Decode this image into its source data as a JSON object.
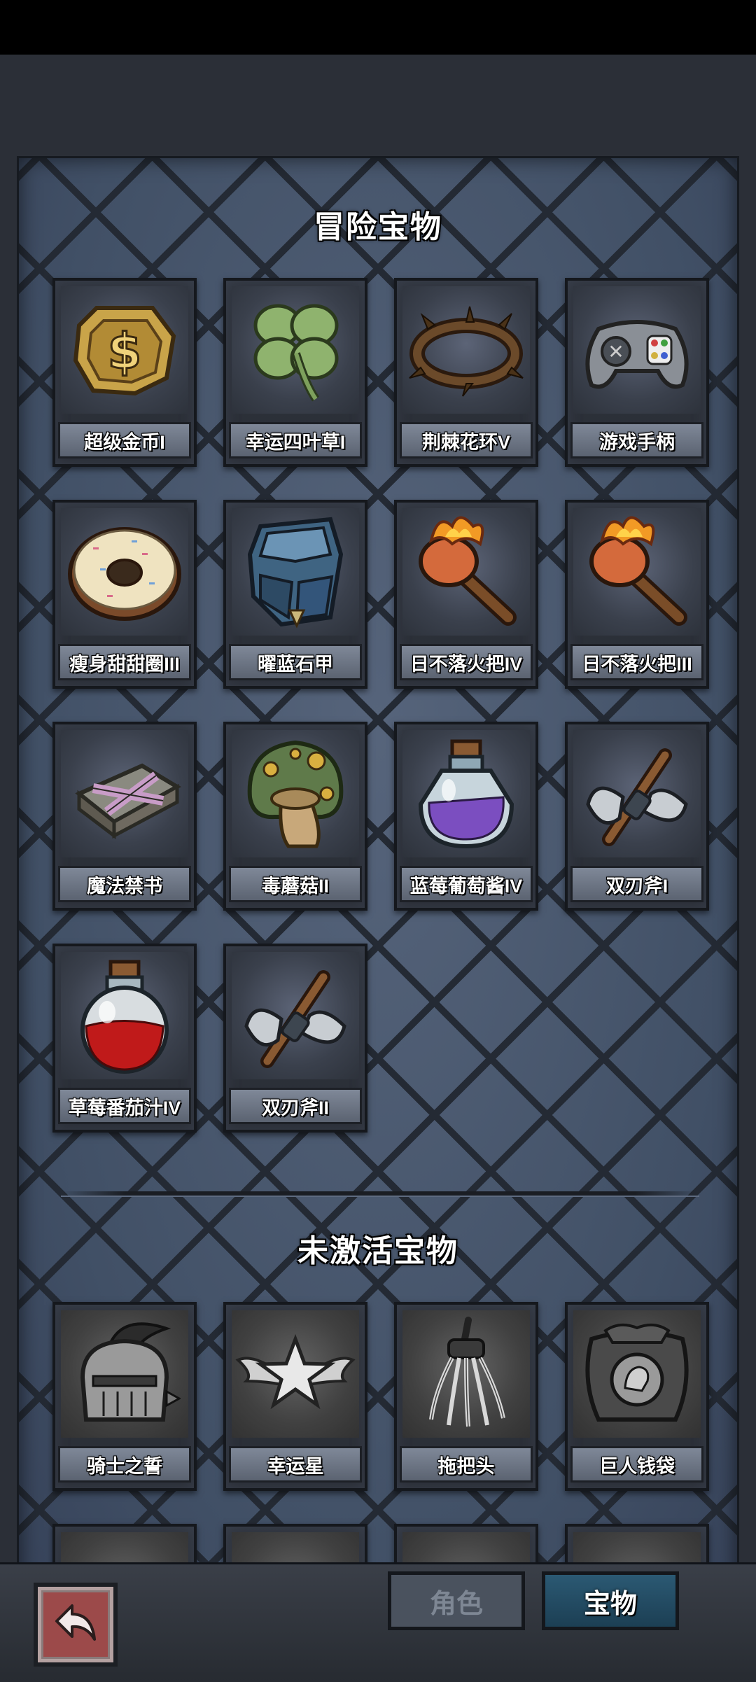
{
  "sections": {
    "active_title": "冒险宝物",
    "inactive_title": "未激活宝物"
  },
  "active_items": [
    {
      "label": "超级金币I",
      "icon": "gold-coin-icon"
    },
    {
      "label": "幸运四叶草I",
      "icon": "four-leaf-clover-icon"
    },
    {
      "label": "荆棘花环V",
      "icon": "thorn-wreath-icon"
    },
    {
      "label": "游戏手柄",
      "icon": "gamepad-icon"
    },
    {
      "label": "瘦身甜甜圈III",
      "icon": "donut-icon"
    },
    {
      "label": "曜蓝石甲",
      "icon": "blue-stone-armor-icon"
    },
    {
      "label": "日不落火把IV",
      "icon": "torch-icon"
    },
    {
      "label": "日不落火把III",
      "icon": "torch-icon"
    },
    {
      "label": "魔法禁书",
      "icon": "forbidden-book-icon"
    },
    {
      "label": "毒蘑菇II",
      "icon": "poison-mushroom-icon"
    },
    {
      "label": "蓝莓葡萄酱IV",
      "icon": "purple-potion-icon"
    },
    {
      "label": "双刃斧I",
      "icon": "double-axe-icon"
    },
    {
      "label": "草莓番茄汁IV",
      "icon": "red-potion-icon"
    },
    {
      "label": "双刃斧II",
      "icon": "double-axe-icon"
    }
  ],
  "inactive_items": [
    {
      "label": "骑士之誓",
      "icon": "knight-helmet-icon"
    },
    {
      "label": "幸运星",
      "icon": "winged-star-icon"
    },
    {
      "label": "拖把头",
      "icon": "mop-head-icon"
    },
    {
      "label": "巨人钱袋",
      "icon": "giant-money-bag-icon"
    },
    {
      "label": "",
      "icon": "partial-item-icon"
    },
    {
      "label": "",
      "icon": "partial-item-icon"
    },
    {
      "label": "",
      "icon": "partial-item-icon"
    },
    {
      "label": "",
      "icon": "partial-item-icon"
    }
  ],
  "bottom_nav": {
    "back_icon": "back-arrow-icon",
    "tab_role": "角色",
    "tab_treasure": "宝物",
    "selected": "宝物"
  }
}
